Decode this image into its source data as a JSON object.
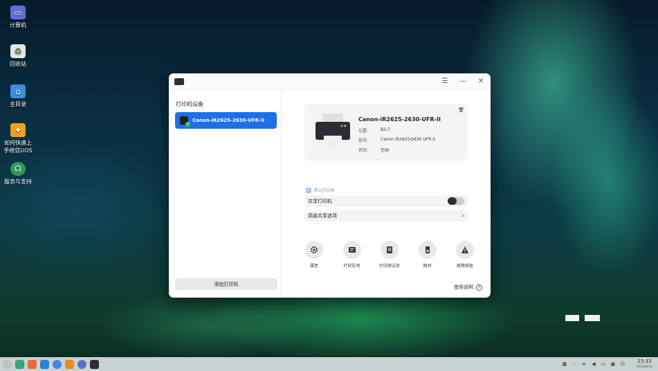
{
  "desktop": {
    "icons": [
      {
        "label": "计算机",
        "icon": "computer-icon",
        "color": "#5f6fd8"
      },
      {
        "label": "回收站",
        "icon": "trash-icon",
        "color": "#7aa07a"
      },
      {
        "label": "主目录",
        "icon": "home-folder-icon",
        "color": "#3b8ee0"
      },
      {
        "label": "如何快速上手统信UOS",
        "icon": "lightbulb-icon",
        "color": "#f0a020"
      },
      {
        "label": "服务与支持",
        "icon": "support-icon",
        "color": "#2c9c5a"
      }
    ]
  },
  "window": {
    "title_icon": "printer-app-icon",
    "controls": {
      "menu": "☰",
      "minimize": "—",
      "close": "✕"
    },
    "sidebar": {
      "heading": "打印机设备",
      "printers": [
        {
          "name": "Canon-iR2625-2630-UFR-II",
          "selected": true
        }
      ],
      "add_button": "添加打印机"
    },
    "detail": {
      "printer_name": "Canon-iR2625-2630-UFR-II",
      "fields": [
        {
          "key": "位置:",
          "value": "B3-7"
        },
        {
          "key": "型号:",
          "value": "Canon iR2625/2630 UFR II"
        },
        {
          "key": "状态:",
          "value": "空闲"
        }
      ],
      "default_label": "默认打印机",
      "share_label": "共享打印机",
      "share_enabled": false,
      "advanced_label": "高级共享选项",
      "actions": [
        {
          "label": "属性",
          "icon": "gear-icon"
        },
        {
          "label": "打印队列",
          "icon": "queue-icon"
        },
        {
          "label": "打印测试页",
          "icon": "test-page-icon"
        },
        {
          "label": "耗材",
          "icon": "supplies-icon"
        },
        {
          "label": "故障排查",
          "icon": "warning-icon"
        }
      ],
      "help_label": "使用说明",
      "help_icon": "?"
    }
  },
  "taskbar": {
    "time": "15:33",
    "date": "2020/09/16"
  }
}
